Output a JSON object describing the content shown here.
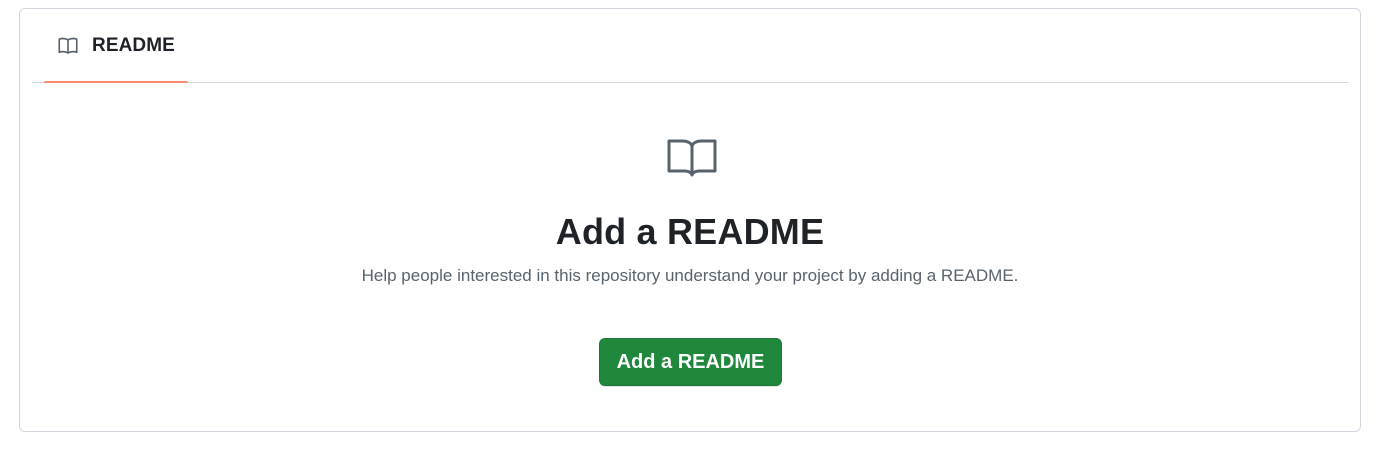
{
  "tab": {
    "label": "README",
    "icon": "book-icon",
    "active_underline_color": "#fd8c73"
  },
  "empty_state": {
    "icon": "book-icon",
    "heading": "Add a README",
    "description": "Help people interested in this repository understand your project by adding a README.",
    "button_label": "Add a README",
    "button_color": "#1f883d"
  }
}
